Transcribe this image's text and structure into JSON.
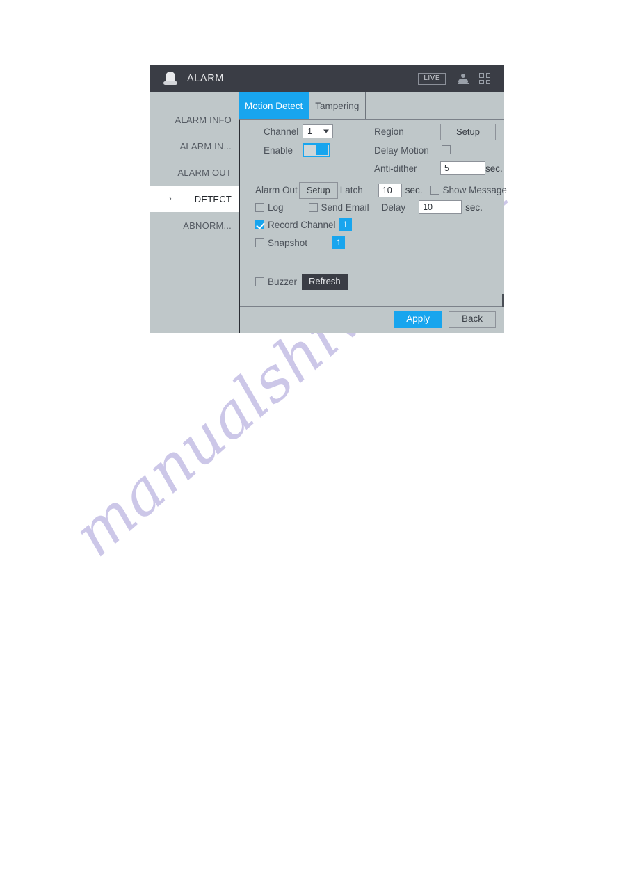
{
  "watermark": {
    "text": "manualshive.com"
  },
  "window": {
    "title": "ALARM",
    "icon": "alarm-beacon-icon",
    "live_label": "LIVE",
    "icons": [
      "user-icon",
      "grid-icon"
    ]
  },
  "sidebar": {
    "items": [
      {
        "label": "ALARM INFO",
        "active": false
      },
      {
        "label": "ALARM IN...",
        "active": false
      },
      {
        "label": "ALARM OUT",
        "active": false
      },
      {
        "label": "DETECT",
        "active": true,
        "chevron": "›"
      },
      {
        "label": "ABNORM...",
        "active": false
      }
    ]
  },
  "tabs": [
    {
      "label": "Motion Detect",
      "active": true
    },
    {
      "label": "Tampering",
      "active": false
    }
  ],
  "form": {
    "channel": {
      "label": "Channel",
      "value": "1"
    },
    "enable": {
      "label": "Enable",
      "state": "on"
    },
    "region": {
      "label": "Region",
      "button": "Setup"
    },
    "delay_motion": {
      "label": "Delay Motion",
      "checked": false
    },
    "anti_dither": {
      "label": "Anti-dither",
      "value": "5",
      "unit": "sec."
    },
    "alarm_out": {
      "label": "Alarm Out",
      "button": "Setup"
    },
    "latch": {
      "label": "Latch",
      "value": "10",
      "unit": "sec."
    },
    "show_message": {
      "label": "Show Message",
      "checked": false
    },
    "log": {
      "label": "Log",
      "checked": false
    },
    "send_email": {
      "label": "Send Email",
      "checked": false
    },
    "delay": {
      "label": "Delay",
      "value": "10",
      "unit": "sec."
    },
    "record_channel": {
      "label": "Record Channel",
      "checked": true,
      "chip": "1"
    },
    "snapshot": {
      "label": "Snapshot",
      "checked": false,
      "chip": "1"
    },
    "buzzer": {
      "label": "Buzzer",
      "checked": false
    },
    "refresh": {
      "label": "Refresh"
    }
  },
  "footer": {
    "apply": "Apply",
    "back": "Back"
  },
  "colors": {
    "accent": "#18a5ee",
    "panel": "#bfc7c9",
    "titlebar": "#3a3d45",
    "watermark": "#b9b2e0"
  }
}
